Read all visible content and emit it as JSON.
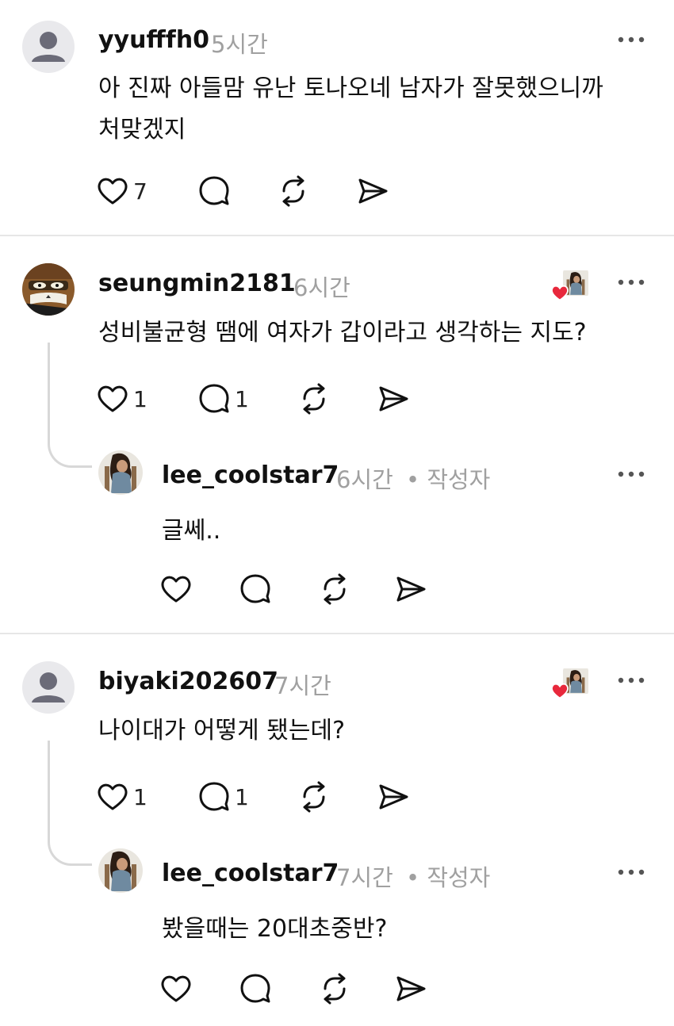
{
  "comments": [
    {
      "username": "yyufffh0",
      "time": "5시간",
      "text_line1": "아 진짜 아들맘 유난 토나오네 남자가 잘못했으니까",
      "text_line2": "처맞겠지",
      "like_count": "7",
      "avatar": "default-person-icon"
    },
    {
      "username": "seungmin2181",
      "time": "6시간",
      "text": "성비불균형 땜에 여자가 갑이라고 생각하는 지도?",
      "like_count": "1",
      "reply_count": "1",
      "avatar": "cartoon-cat-avatar",
      "reply": {
        "username": "lee_coolstar7",
        "time": "6시간",
        "author_tag": "• 작성자",
        "text": "글쎄.."
      }
    },
    {
      "username": "biyaki202607",
      "time": "7시간",
      "text": "나이대가 어떻게 됐는데?",
      "like_count": "1",
      "reply_count": "1",
      "avatar": "default-person-icon",
      "reply": {
        "username": "lee_coolstar7",
        "time": "7시간",
        "author_tag": "• 작성자",
        "text": "봤을때는 20대초중반?"
      }
    }
  ],
  "colors": {
    "heart_red": "#e8283c",
    "muted_text": "#a0a0a0",
    "divider": "#e6e6e6"
  }
}
